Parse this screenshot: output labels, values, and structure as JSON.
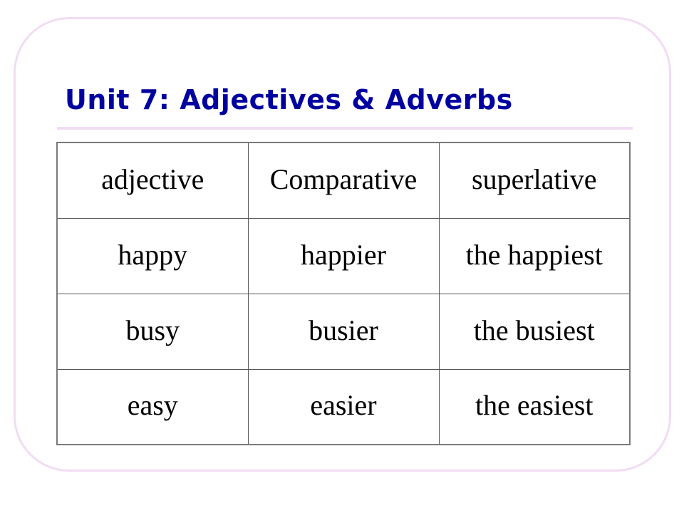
{
  "slide": {
    "title": "Unit 7: Adjectives & Adverbs",
    "colors": {
      "title": "#0000A0",
      "frame": "#F2DCF4",
      "table_border": "#777777"
    }
  },
  "table": {
    "headers": [
      "adjective",
      "Comparative",
      "superlative"
    ],
    "rows": [
      [
        "happy",
        "happier",
        "the happiest"
      ],
      [
        "busy",
        "busier",
        "the busiest"
      ],
      [
        "easy",
        "easier",
        "the easiest"
      ]
    ]
  }
}
